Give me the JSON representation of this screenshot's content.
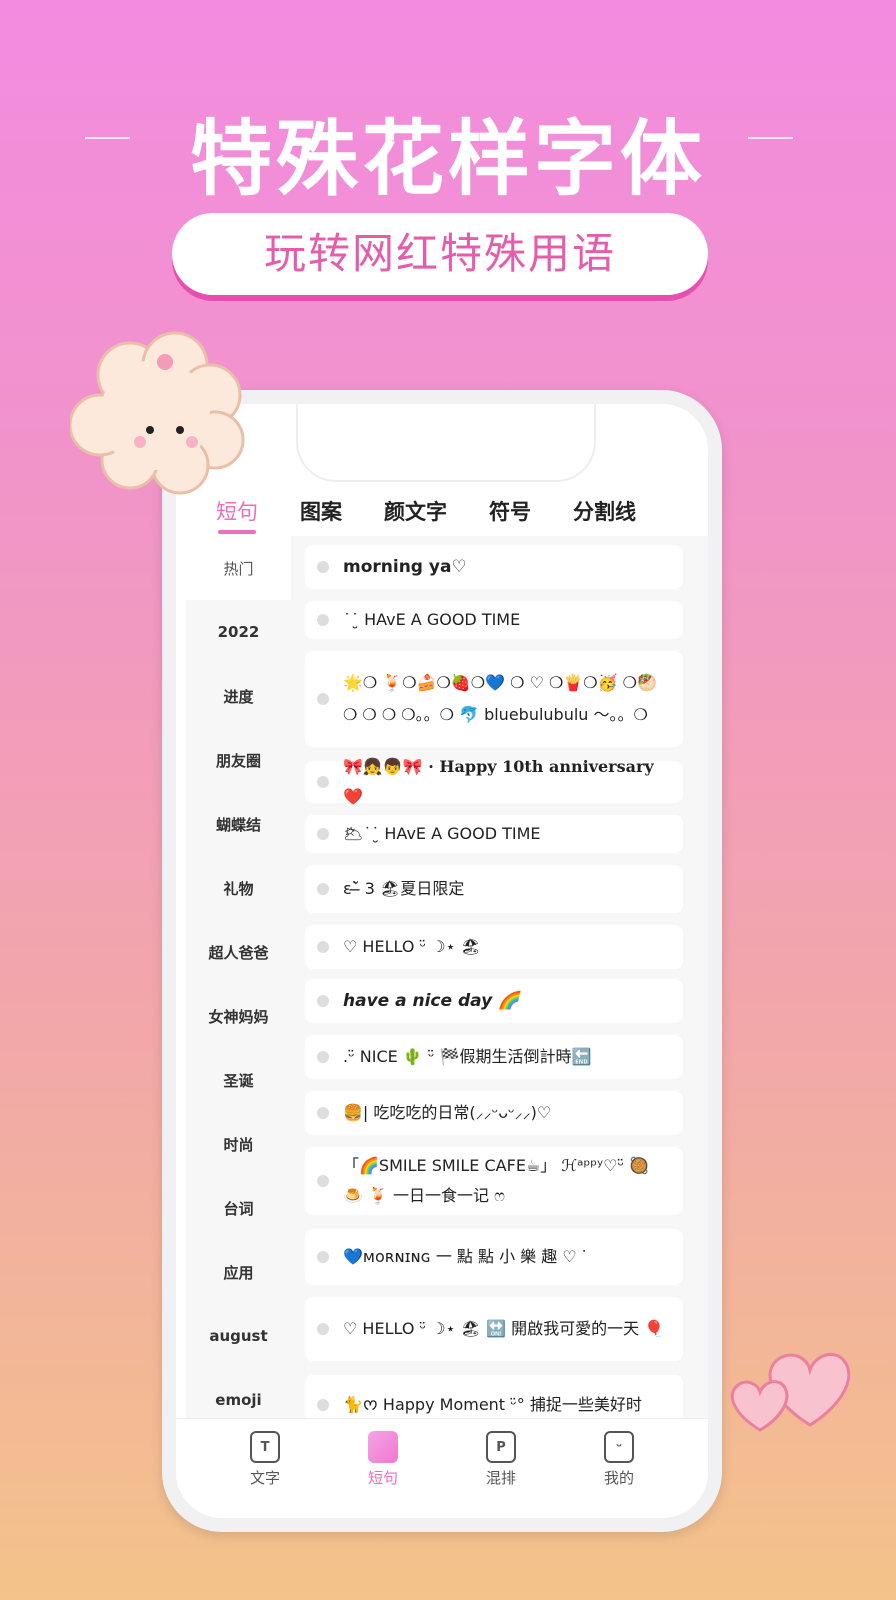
{
  "promo": {
    "title": "特殊花样字体",
    "subtitle": "玩转网红特殊用语"
  },
  "tabs": [
    {
      "label": "短句",
      "active": true
    },
    {
      "label": "图案"
    },
    {
      "label": "颜文字"
    },
    {
      "label": "符号"
    },
    {
      "label": "分割线"
    }
  ],
  "sidebar": [
    {
      "label": "热门",
      "active": true
    },
    {
      "label": "2022"
    },
    {
      "label": "进度"
    },
    {
      "label": "朋友圈"
    },
    {
      "label": "蝴蝶结"
    },
    {
      "label": "礼物"
    },
    {
      "label": "超人爸爸"
    },
    {
      "label": "女神妈妈"
    },
    {
      "label": "圣诞"
    },
    {
      "label": "时尚"
    },
    {
      "label": "台词"
    },
    {
      "label": "应用"
    },
    {
      "label": "august"
    },
    {
      "label": "emoji"
    }
  ],
  "items": [
    "morning ya♡",
    "˙˙̮ HAvE A GOOD TIME",
    "🌟❍ 🍹❍🍰❍🍓❍💙 ❍ ♡ ❍🍟❍🥳 ❍🥙❍ ❍ ❍ ❍。。❍ 🐬 bluebulubulu ～。。❍",
    "🎀👧👦🎀 · Happy 10th anniversary ❤️",
    "🌥˙˙̮ HAvE A GOOD TIME",
    "ε˘̶̀ 3 🏖夏日限定",
    "♡ HELLO ᵕ̈ ☽⋆ 🏖",
    "have a nice day 🌈",
    ".ᵕ̈ NICE 🌵 ᵕ̈ 🏁假期生活倒計時🔚",
    "🍔| 吃吃吃的日常(⸝⸝ᵕᴗᵕ⸝⸝)♡",
    "「🌈SMILE SMILE CAFE☕」 ℋᵃᵖᵖʸ♡ᵕ̈ 🥘 🍮 🍹 一日一食一记 ෆ",
    "💙ᴍᴏʀɴɪɴɢ 一 點 點 小 樂 趣 ♡ ᐝ",
    "♡ HELLO ᵕ̈ ☽⋆ 🏖 🔛 開啟我可愛的一天 🎈",
    "🐈ᰔ Happy Moment ᵕ̈° 捕捉一些美好时"
  ],
  "nav": [
    {
      "label": "文字",
      "icon": "T"
    },
    {
      "label": "短句",
      "icon": "",
      "active": true
    },
    {
      "label": "混排",
      "icon": "P"
    },
    {
      "label": "我的",
      "icon": "ᵕ"
    }
  ],
  "colors": {
    "accent": "#ef6dc1",
    "bg_top": "#f38be0",
    "bg_bottom": "#f3c38a"
  }
}
